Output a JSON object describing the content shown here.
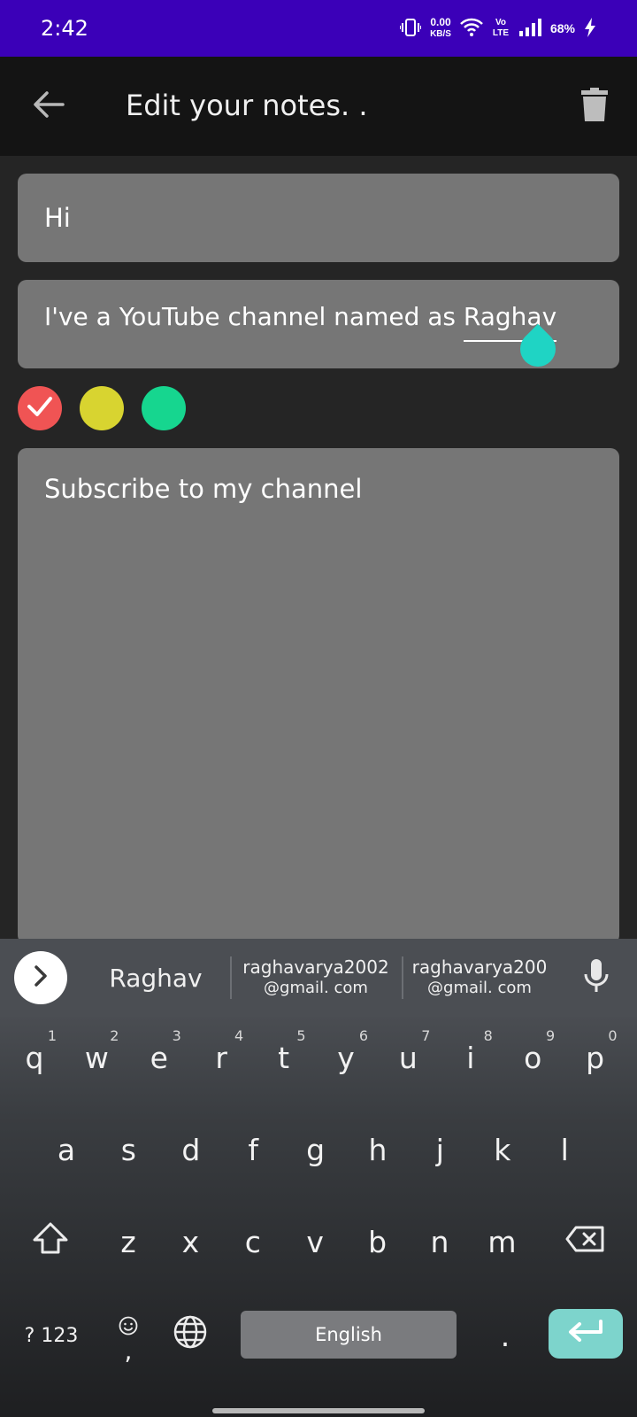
{
  "status_bar": {
    "time": "2:42",
    "net_speed": "0.00",
    "net_unit": "KB/S",
    "volte": "Vo LTE",
    "battery": "68%"
  },
  "app_bar": {
    "title": "Edit your notes. ."
  },
  "note": {
    "title_value": "Hi",
    "subtitle_value_prefix": "I've a YouTube channel named as ",
    "subtitle_value_word": "Raghav",
    "body_value": "Subscribe to my channel"
  },
  "colors": {
    "options": [
      "#f05454",
      "#d8d430",
      "#16d68f"
    ],
    "selected_index": 0
  },
  "keyboard": {
    "suggestions": [
      {
        "line1": "Raghav",
        "line2": ""
      },
      {
        "line1": "raghavarya2002",
        "line2": "@gmail. com"
      },
      {
        "line1": "raghavarya200",
        "line2": "@gmail. com"
      }
    ],
    "row1": [
      {
        "key": "q",
        "hint": "1"
      },
      {
        "key": "w",
        "hint": "2"
      },
      {
        "key": "e",
        "hint": "3"
      },
      {
        "key": "r",
        "hint": "4"
      },
      {
        "key": "t",
        "hint": "5"
      },
      {
        "key": "y",
        "hint": "6"
      },
      {
        "key": "u",
        "hint": "7"
      },
      {
        "key": "i",
        "hint": "8"
      },
      {
        "key": "o",
        "hint": "9"
      },
      {
        "key": "p",
        "hint": "0"
      }
    ],
    "row2": [
      "a",
      "s",
      "d",
      "f",
      "g",
      "h",
      "j",
      "k",
      "l"
    ],
    "row3": [
      "z",
      "x",
      "c",
      "v",
      "b",
      "n",
      "m"
    ],
    "symbols_label": "? 123",
    "comma_label": ",",
    "space_label": "English",
    "period_label": "."
  }
}
